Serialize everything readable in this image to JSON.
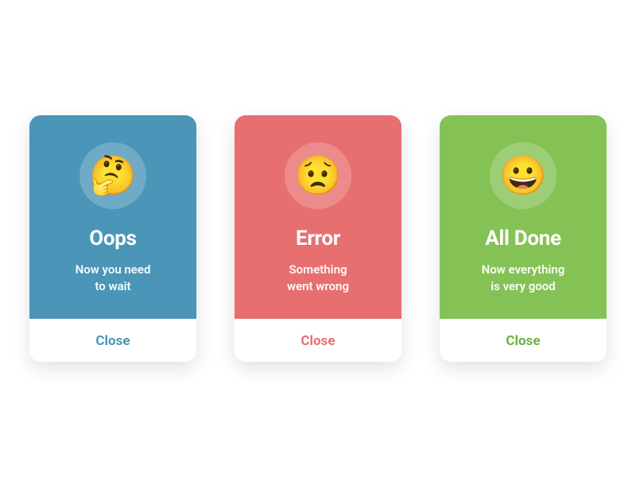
{
  "cards": {
    "oops": {
      "emoji": "🤔",
      "title": "Oops",
      "message": "Now you need\nto wait",
      "close": "Close",
      "color": "#4b95b8"
    },
    "error": {
      "emoji": "😟",
      "title": "Error",
      "message": "Something\nwent wrong",
      "close": "Close",
      "color": "#e76f6f"
    },
    "done": {
      "emoji": "😀",
      "title": "All Done",
      "message": "Now everything\nis very good",
      "close": "Close",
      "color": "#85c256"
    }
  }
}
